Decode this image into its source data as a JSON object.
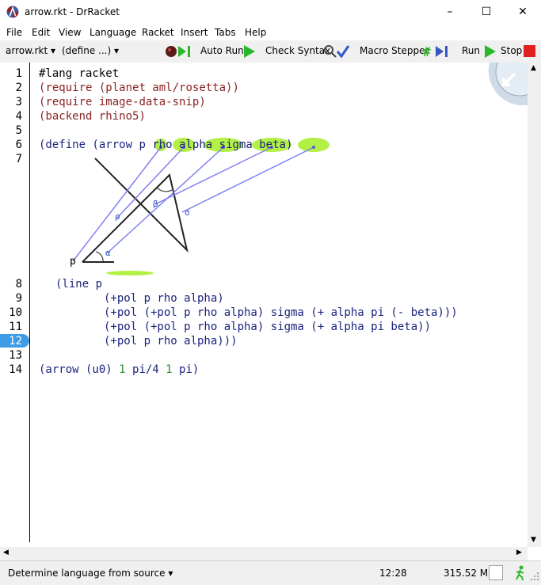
{
  "window": {
    "title": "arrow.rkt - DrRacket",
    "minimize": "–",
    "maximize": "☐",
    "close": "✕"
  },
  "menu": [
    "File",
    "Edit",
    "View",
    "Language",
    "Racket",
    "Insert",
    "Tabs",
    "Help"
  ],
  "toolbar": {
    "file_dropdown": "arrow.rkt",
    "define_dropdown": "(define ...)",
    "auto_run": "Auto Run",
    "check_syntax": "Check Syntax",
    "macro_stepper": "Macro Stepper",
    "run": "Run",
    "stop": "Stop"
  },
  "editor": {
    "current_line": "12",
    "line_numbers": [
      "1",
      "2",
      "3",
      "4",
      "5",
      "6",
      "7",
      "8",
      "9",
      "10",
      "11",
      "12",
      "13",
      "14"
    ],
    "lines": {
      "l1": "#lang racket",
      "l2_open": "(",
      "l2_kw": "require",
      "l2_rest": " (planet aml/rosetta))",
      "l3_open": "(",
      "l3_kw": "require",
      "l3_rest": " image-data-snip)",
      "l4_open": "(",
      "l4_kw": "backend",
      "l4_rest": " rhino5)",
      "l6_a": "(define (arrow ",
      "l6_p": "p",
      "l6_rho": "rho",
      "l6_alpha": "alpha",
      "l6_sigma": "sigma",
      "l6_beta": "beta",
      "l6_close": ")",
      "l8": "(line p",
      "l9": "(+pol p rho alpha)",
      "l10": "(+pol (+pol p rho alpha) sigma (+ alpha pi (- beta)))",
      "l11": "(+pol (+pol p rho alpha) sigma (+ alpha pi beta))",
      "l12": "(+pol p rho alpha)))",
      "l14_open": "(arrow (u0) ",
      "l14_n1": "1",
      "l14_sp": " pi/4 ",
      "l14_n2": "1",
      "l14_sp2": " pi)"
    },
    "image_labels": {
      "p": "p",
      "rho": "ρ",
      "alpha": "α",
      "sigma": "σ",
      "beta": "β"
    }
  },
  "status": {
    "language": "Determine language from source",
    "position": "12:28",
    "memory": "315.52 MB"
  },
  "colors": {
    "paren": "#8b2323",
    "keyword": "#1a237e",
    "number": "#2e8b2e",
    "highlight": "#b3f046",
    "arrow": "#8080f0",
    "linehl": "#3e9be6"
  }
}
